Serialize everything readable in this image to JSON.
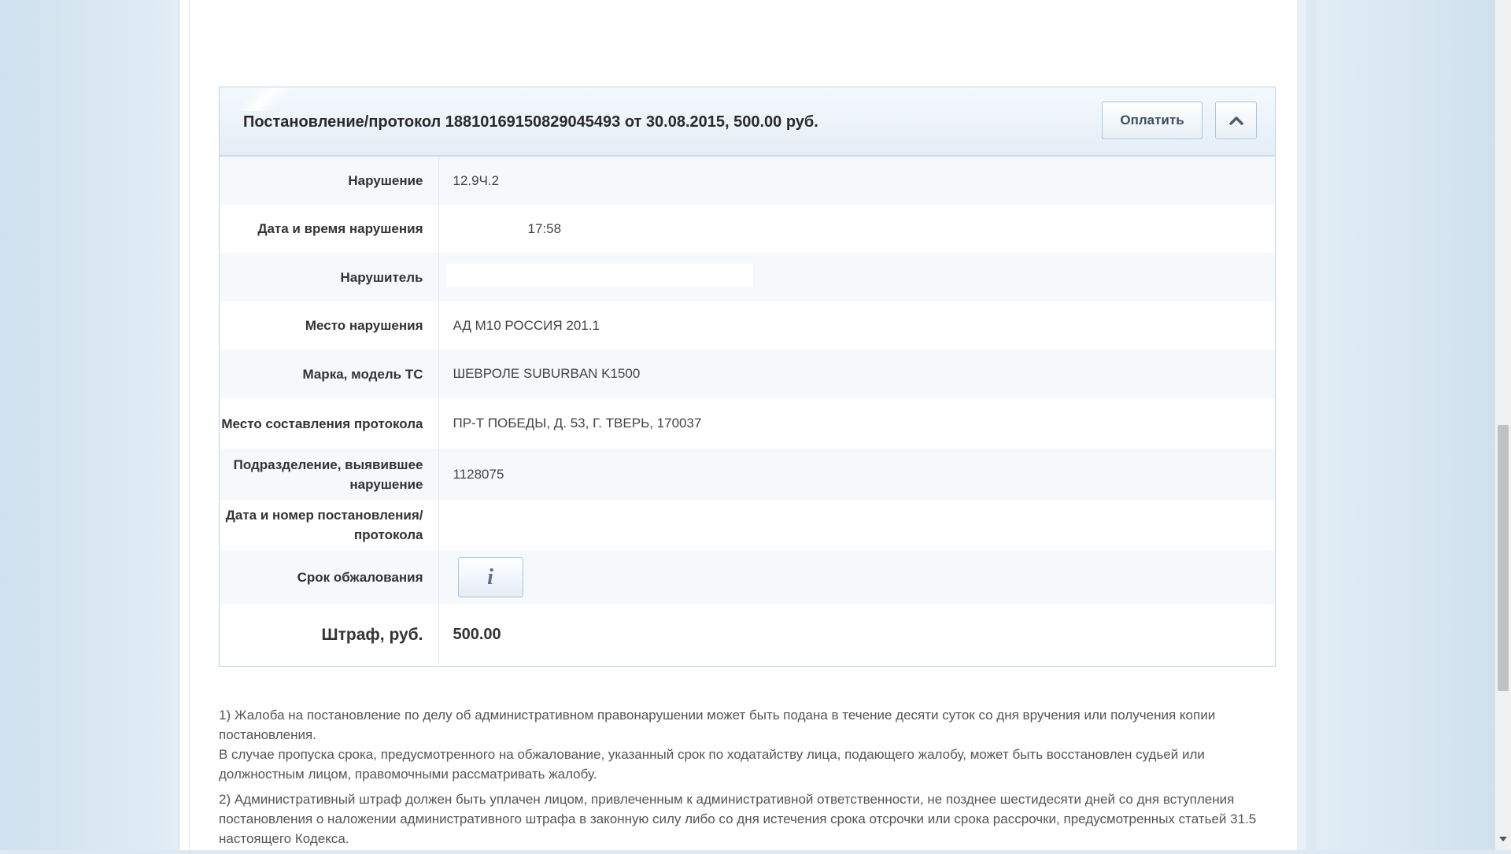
{
  "card": {
    "title": "Постановление/протокол 18810169150829045493 от 30.08.2015, 500.00 руб.",
    "pay_button": "Оплатить",
    "collapse_icon": "chevron-up-icon",
    "rows": [
      {
        "label": "Нарушение",
        "value": "12.9Ч.2"
      },
      {
        "label": "Дата и время нарушения",
        "value": "17:58"
      },
      {
        "label": "Нарушитель",
        "value": ""
      },
      {
        "label": "Место нарушения",
        "value": "АД М10 РОССИЯ 201.1"
      },
      {
        "label": "Марка, модель ТС",
        "value": "ШЕВРОЛЕ SUBURBAN K1500"
      },
      {
        "label": "Место составления протокола",
        "value": "ПР-Т ПОБЕДЫ, Д. 53, Г. ТВЕРЬ, 170037"
      },
      {
        "label": "Подразделение, выявившее нарушение",
        "value": "1128075"
      },
      {
        "label": "Дата и номер постановления/протокола",
        "value": ""
      },
      {
        "label": "Срок обжалования",
        "value": "i"
      },
      {
        "label": "Штраф, руб.",
        "value": "500.00"
      }
    ]
  },
  "notes": {
    "n1a": "1) Жалоба на постановление по делу об административном правонарушении может быть подана в течение десяти суток со дня вручения или получения копии постановления.",
    "n1b": "В случае пропуска срока, предусмотренного на обжалование, указанный срок по ходатайству лица, подающего жалобу, может быть восстановлен судьей или должностным лицом, правомочными рассматривать жалобу.",
    "n2": "2) Административный штраф должен быть уплачен лицом, привлеченным к административной ответственности, не позднее шестидесяти дней со дня вступления постановления о наложении административного штрафа в законную силу либо со дня истечения срока отсрочки или срока рассрочки, предусмотренных статьей 31.5 настоящего Кодекса."
  },
  "colors": {
    "accent_border": "#b8d4e8",
    "row_alt": "#f5f9fc",
    "text_dark": "#2a2a2a"
  }
}
